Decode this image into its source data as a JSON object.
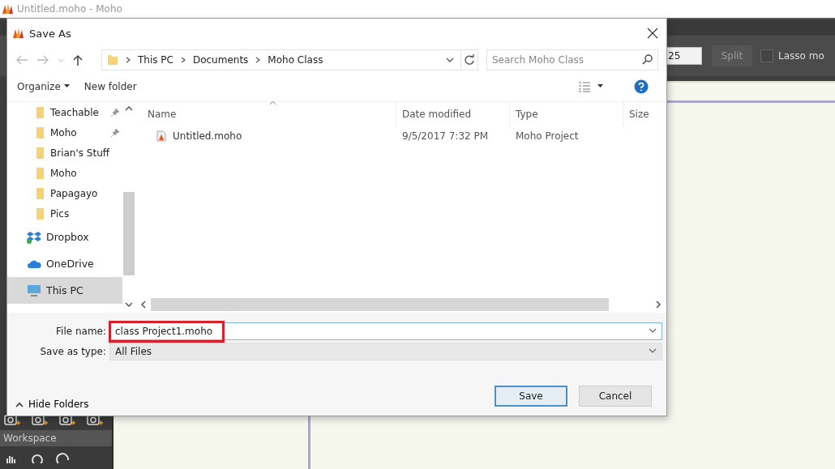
{
  "app": {
    "title": "Untitled.moho - Moho",
    "toolbar": {
      "field_value": "25",
      "split_button": "Split",
      "lasso": {
        "label": "Lasso mo",
        "checked": false
      }
    },
    "workspace_label": "Workspace"
  },
  "dialog": {
    "title": "Save As",
    "breadcrumb": [
      "This PC",
      "Documents",
      "Moho Class"
    ],
    "search": {
      "placeholder": "Search Moho Class"
    },
    "toolbar": {
      "organize": "Organize",
      "new_folder": "New folder"
    },
    "sidebar": {
      "items": [
        {
          "label": "Teachable",
          "kind": "folder",
          "pinned": true,
          "selected": false
        },
        {
          "label": "Moho",
          "kind": "folder",
          "pinned": true,
          "selected": false
        },
        {
          "label": "Brian's Stuff",
          "kind": "folder",
          "pinned": false,
          "selected": false
        },
        {
          "label": "Moho",
          "kind": "folder",
          "pinned": false,
          "selected": false
        },
        {
          "label": "Papagayo",
          "kind": "folder",
          "pinned": false,
          "selected": false
        },
        {
          "label": "Pics",
          "kind": "folder",
          "pinned": false,
          "selected": false
        },
        {
          "label": "Dropbox",
          "kind": "dropbox",
          "pinned": false,
          "selected": false
        },
        {
          "label": "OneDrive",
          "kind": "onedrive",
          "pinned": false,
          "selected": false
        },
        {
          "label": "This PC",
          "kind": "pc",
          "pinned": false,
          "selected": true
        }
      ]
    },
    "table": {
      "columns": [
        "Name",
        "Date modified",
        "Type",
        "Size"
      ],
      "rows": [
        {
          "name": "Untitled.moho",
          "date": "9/5/2017 7:32 PM",
          "type": "Moho Project"
        }
      ]
    },
    "file_name": {
      "label": "File name:",
      "value": "class Project1.moho",
      "highlighted": true
    },
    "save_as_type": {
      "label": "Save as type:",
      "value": "All Files"
    },
    "hide_folders": "Hide Folders",
    "buttons": [
      {
        "label": "Save",
        "default": true
      },
      {
        "label": "Cancel",
        "default": false
      }
    ]
  }
}
